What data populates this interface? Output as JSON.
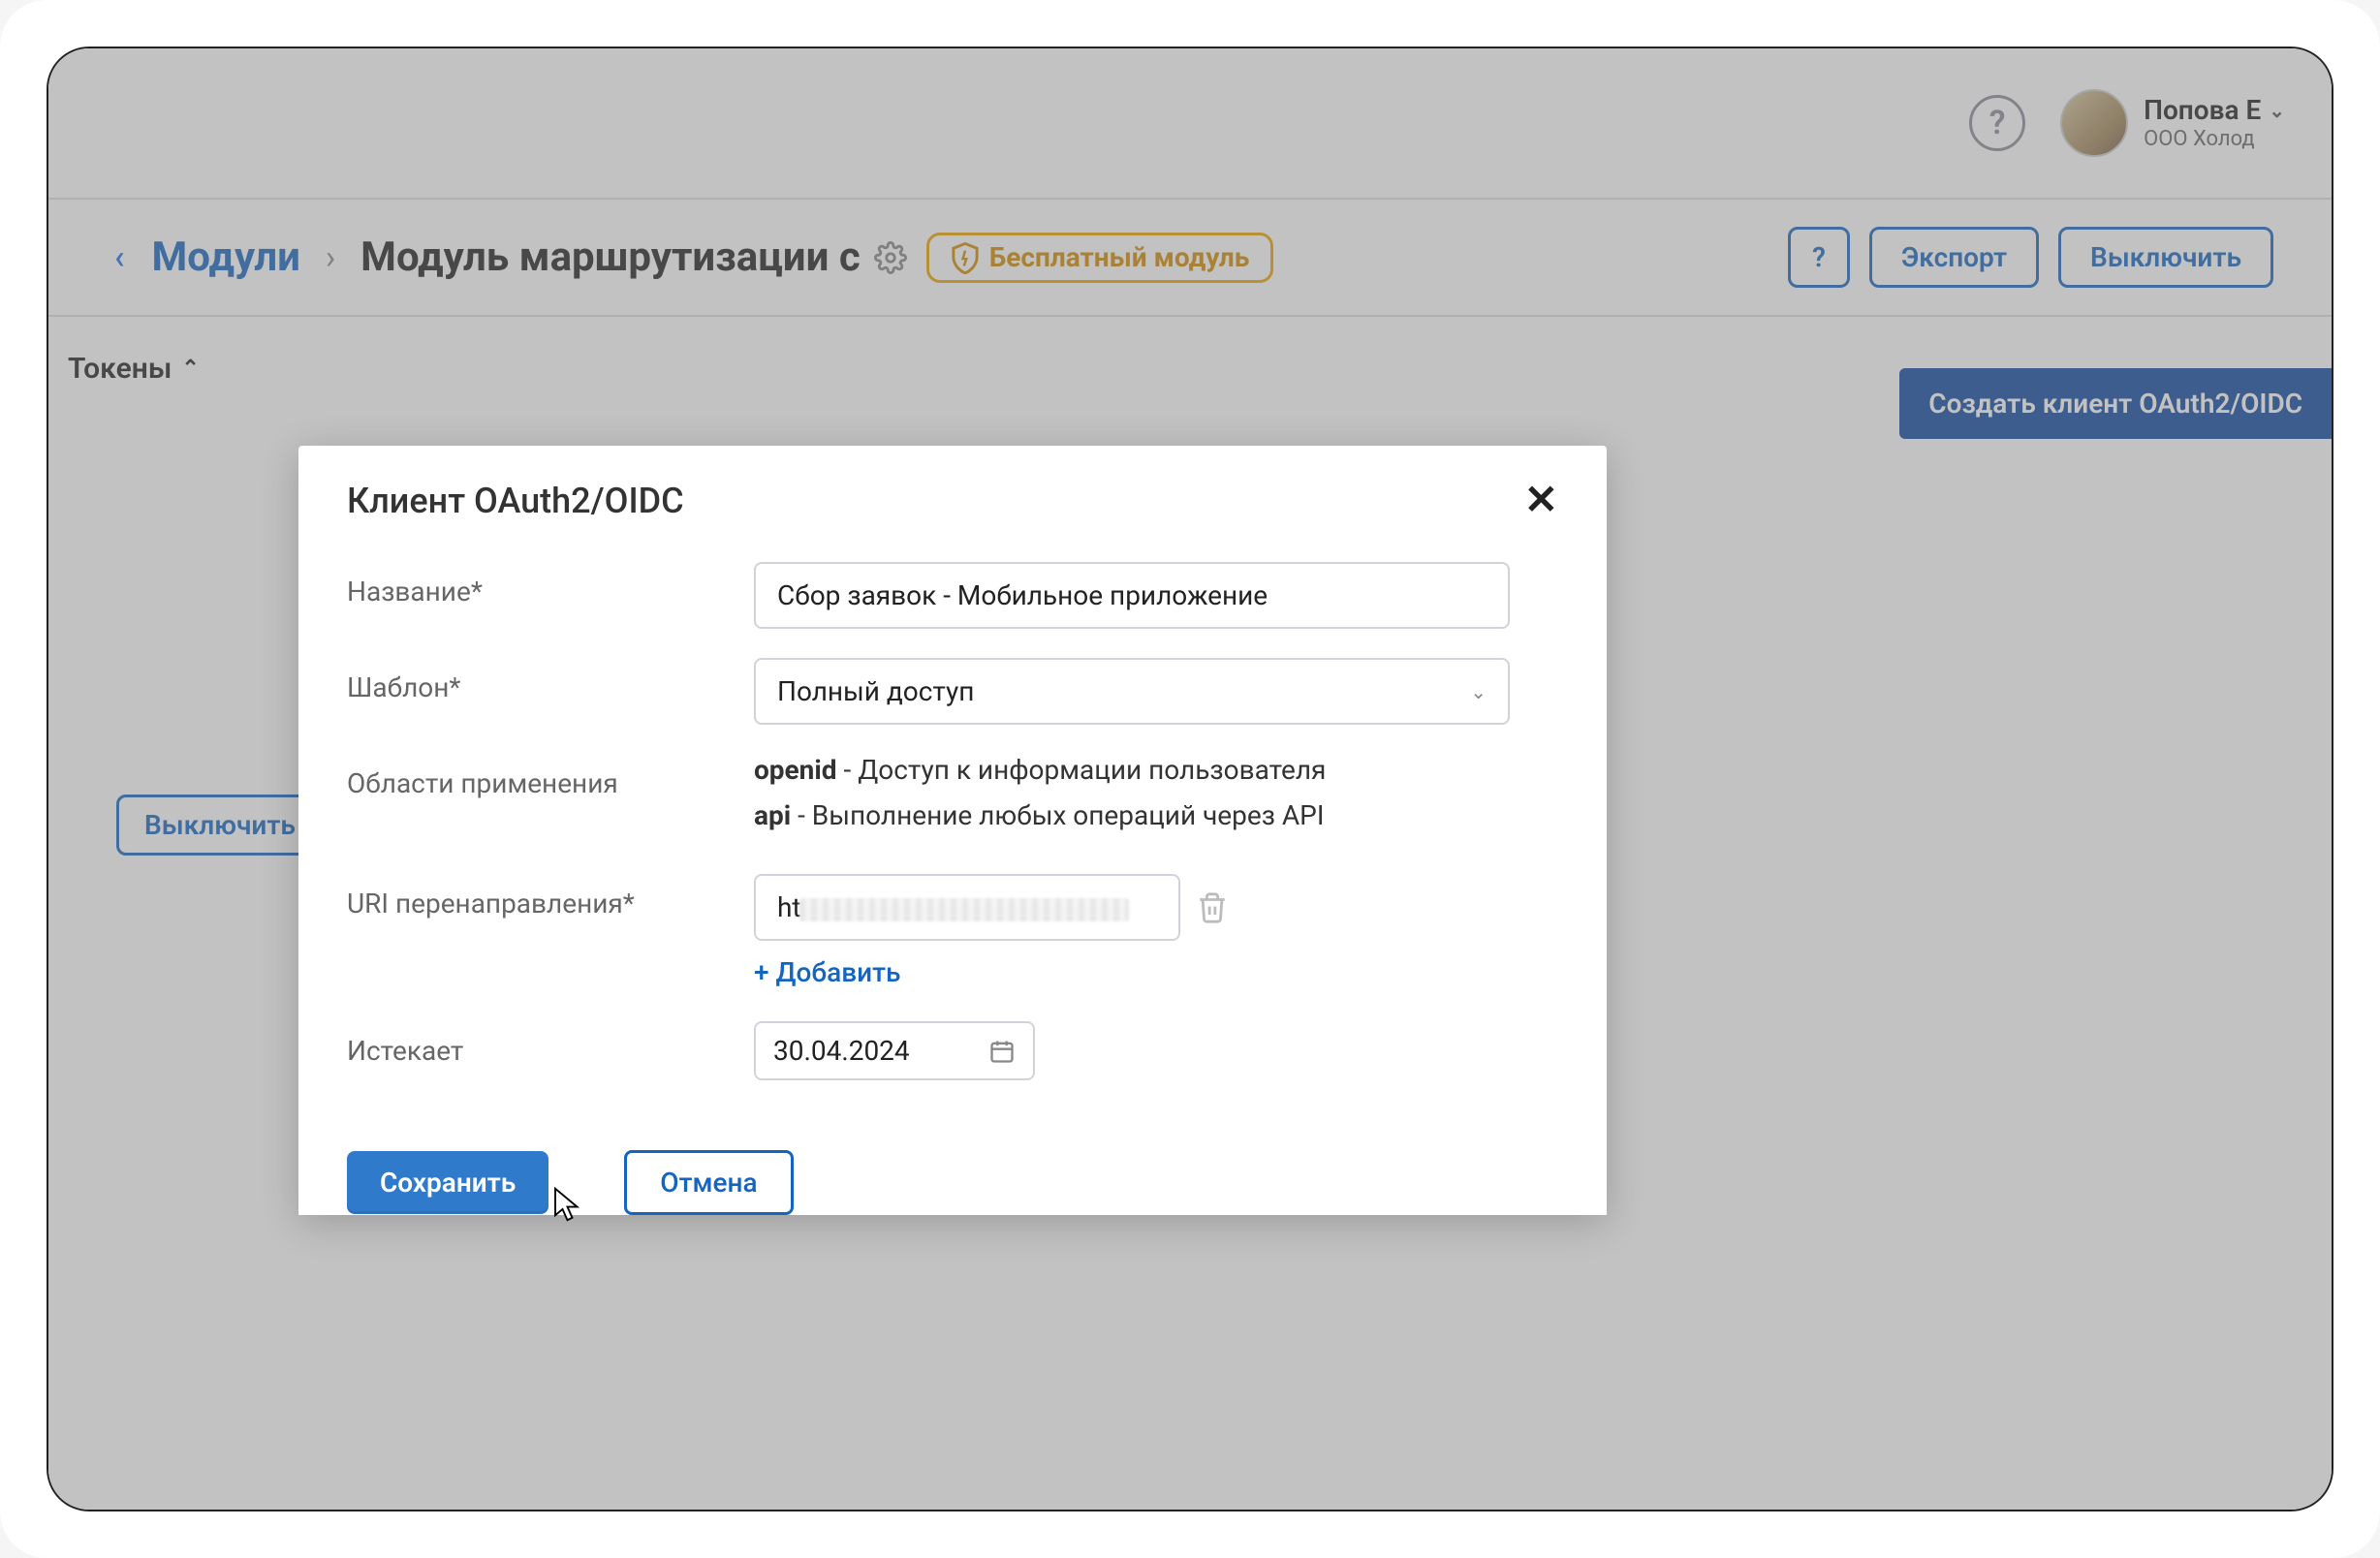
{
  "header": {
    "user_name": "Попова Е",
    "user_org": "ООО Холод"
  },
  "breadcrumb": {
    "back_label": "Модули",
    "title": "Модуль маршрутизации с",
    "free_badge": "Бесплатный модуль",
    "export_label": "Экспорт",
    "disable_label": "Выключить",
    "help_symbol": "?"
  },
  "tokens": {
    "toggle_label": "Токены",
    "create_button": "Создать клиент OAuth2/OIDC",
    "disable_bg": "Выключить"
  },
  "modal": {
    "title": "Клиент OAuth2/OIDC",
    "labels": {
      "name": "Название*",
      "template": "Шаблон*",
      "scopes": "Области применения",
      "redirect": "URI перенаправления*",
      "expires": "Истекает"
    },
    "name_value": "Сбор заявок - Мобильное приложение",
    "template_value": "Полный доступ",
    "scopes": [
      {
        "key": "openid",
        "desc": "Доступ к информации пользователя"
      },
      {
        "key": "api",
        "desc": "Выполнение любых операций через API"
      }
    ],
    "redirect_prefix": "ht",
    "add_uri": "+ Добавить",
    "expires_value": "30.04.2024",
    "save": "Сохранить",
    "cancel": "Отмена"
  }
}
